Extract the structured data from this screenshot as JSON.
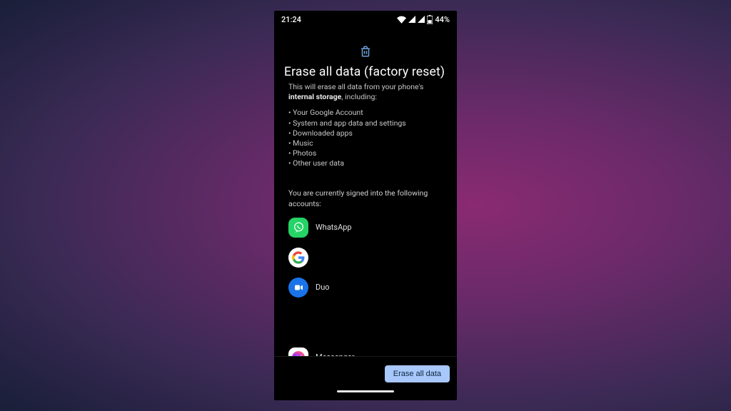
{
  "status": {
    "time": "21:24",
    "battery_pct": "44%"
  },
  "header": {
    "title": "Erase all data (factory reset)",
    "intro_prefix": "This will erase all data from your phone's ",
    "intro_strong": "internal storage",
    "intro_suffix": ", including:"
  },
  "bullets": [
    "Your Google Account",
    "System and app data and settings",
    "Downloaded apps",
    "Music",
    "Photos",
    "Other user data"
  ],
  "accounts_heading": "You are currently signed into the following accounts:",
  "accounts": [
    {
      "name": "WhatsApp",
      "icon": "whatsapp"
    },
    {
      "name": "",
      "icon": "google"
    },
    {
      "name": "Duo",
      "icon": "duo"
    },
    {
      "name": "Messenger",
      "icon": "messenger"
    }
  ],
  "footer": {
    "erase_label": "Erase all data"
  }
}
